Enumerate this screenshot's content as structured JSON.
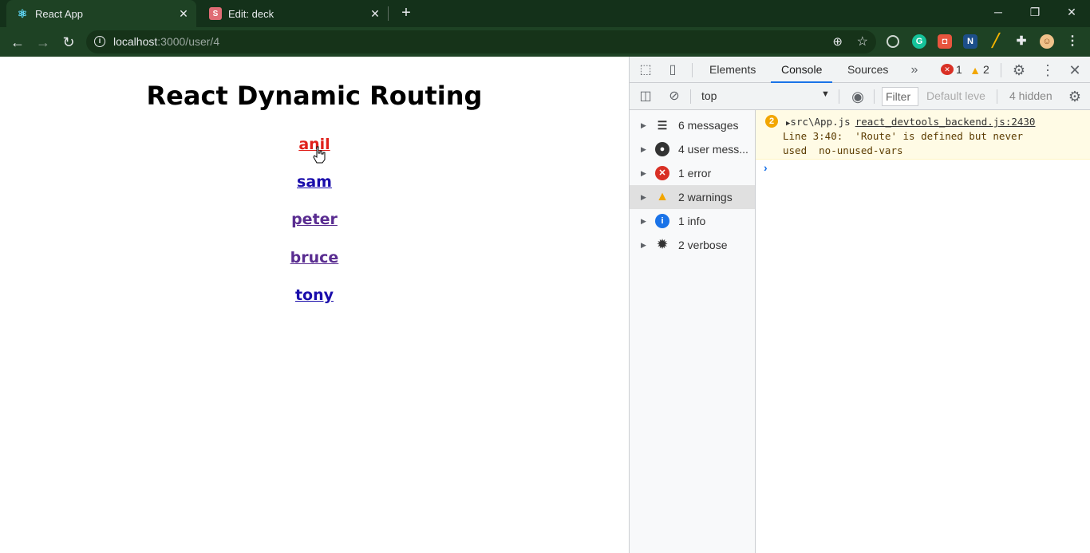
{
  "browser": {
    "tabs": [
      {
        "title": "React App",
        "favicon": "react-icon"
      },
      {
        "title": "Edit: deck",
        "favicon": "S"
      }
    ],
    "url_host": "localhost",
    "url_path": ":3000/user/4"
  },
  "page": {
    "heading": "React Dynamic Routing",
    "users": [
      "anil",
      "sam",
      "peter",
      "bruce",
      "tony"
    ],
    "link_colors": {
      "active": "#e0201b",
      "unvisited": "#1a0dab",
      "visited": "#5a2d91"
    }
  },
  "devtools": {
    "tabs": [
      "Elements",
      "Console",
      "Sources"
    ],
    "active_tab": "Console",
    "error_count": "1",
    "warning_count": "2",
    "context": "top",
    "filter_placeholder": "Filter",
    "levels_label": "Default leve",
    "hidden_label": "4 hidden",
    "sidebar": [
      {
        "label": "6 messages",
        "icon": "list-icon"
      },
      {
        "label": "4 user mess...",
        "icon": "user-icon"
      },
      {
        "label": "1 error",
        "icon": "error-icon"
      },
      {
        "label": "2 warnings",
        "icon": "warning-icon"
      },
      {
        "label": "1 info",
        "icon": "info-icon"
      },
      {
        "label": "2 verbose",
        "icon": "bug-icon"
      }
    ],
    "message": {
      "count": "2",
      "source": "src\\App.js",
      "link": "react_devtools_backend.js:2430",
      "line2": "Line 3:40:  'Route' is defined but never",
      "line3": "used  no-unused-vars"
    }
  }
}
